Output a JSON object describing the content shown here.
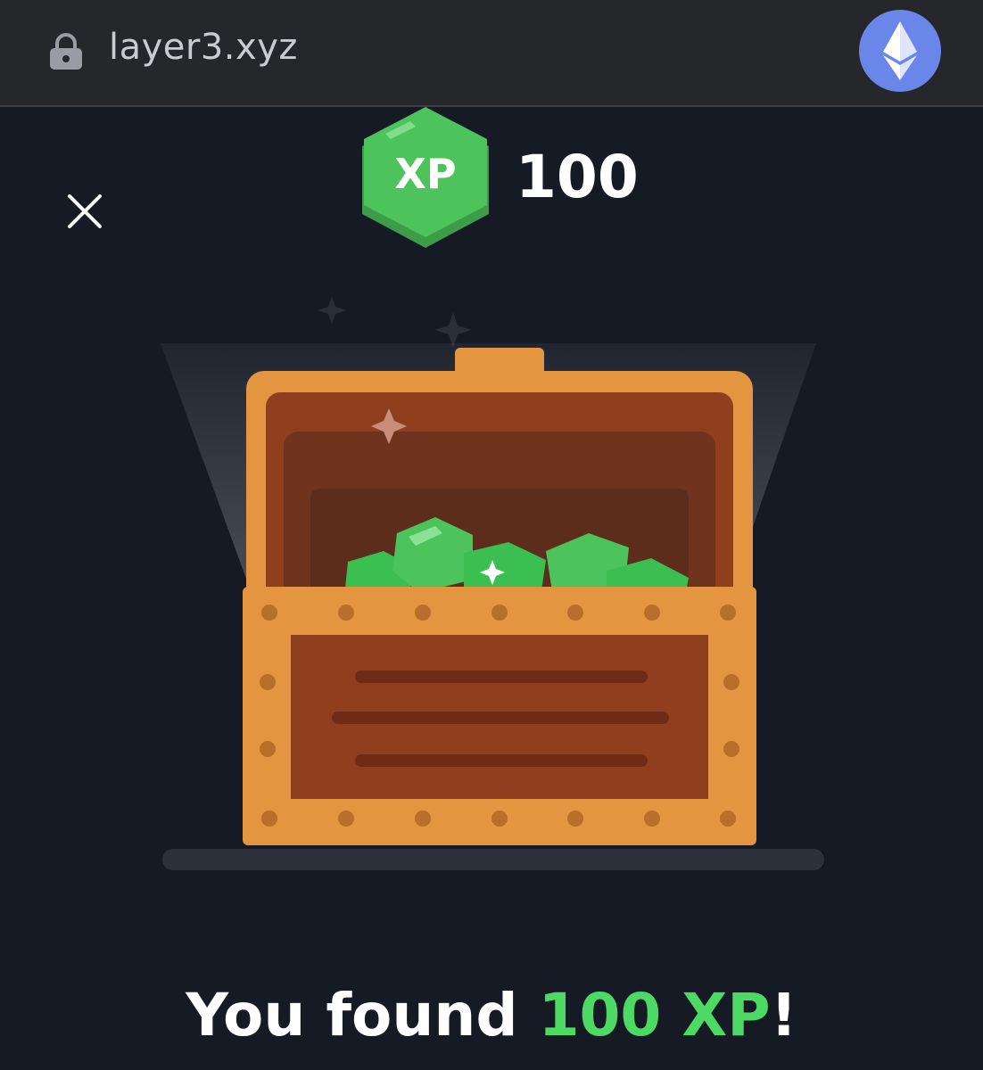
{
  "browser": {
    "url": "layer3.xyz",
    "lock_icon": "lock-icon",
    "network_icon": "ethereum-icon",
    "network_color": "#6a86e8"
  },
  "modal": {
    "close_icon": "close-icon",
    "xp_badge": {
      "label": "XP",
      "color": "#4cc45b"
    },
    "xp_amount": "100",
    "illustration": "treasure-chest-icon",
    "message": {
      "prefix": "You found ",
      "highlight": "100 XP",
      "suffix": "!",
      "highlight_color": "#4cd964"
    }
  }
}
